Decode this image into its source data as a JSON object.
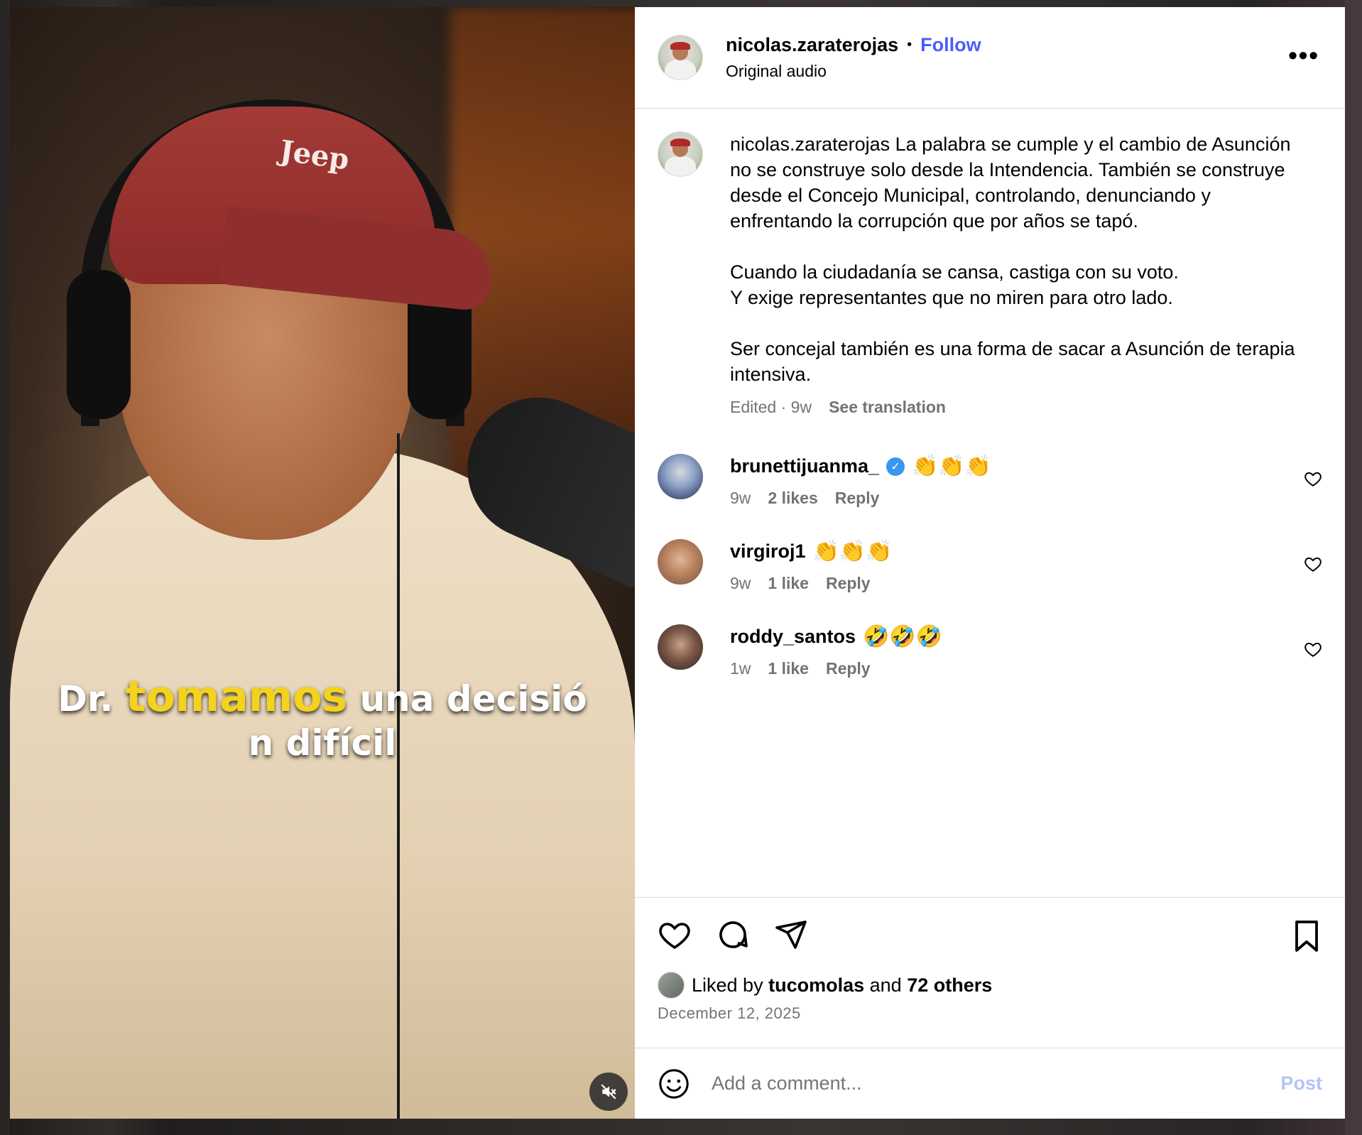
{
  "post": {
    "username": "nicolas.zaraterojas",
    "separator": "•",
    "follow_label": "Follow",
    "audio": "Original audio",
    "more_label": "•••",
    "caption_user": "nicolas.zaraterojas",
    "caption_p1": "La palabra se cumple y el cambio de Asunción no se construye solo desde la Intendencia. También se construye desde el Concejo Municipal, controlando, denunciando y enfrentando la corrupción que por años se tapó.",
    "caption_p2": "Cuando la ciudadanía se cansa, castiga con su voto.\nY exige representantes que no miren para otro lado.",
    "caption_p3": "Ser concejal también es una forma de sacar a Asunción de terapia intensiva.",
    "caption_meta": "Edited · 9w",
    "translation_label": "See translation"
  },
  "video": {
    "caption_line1_a": "Dr.",
    "caption_line1_hl": "tomamos",
    "caption_line1_b": "una decisió",
    "caption_line2": "n difícil",
    "cap_logo": "Jeep"
  },
  "comments": [
    {
      "user": "brunettijuanma_",
      "verified": true,
      "text": "👏👏👏",
      "age": "9w",
      "likes": "2 likes",
      "reply": "Reply"
    },
    {
      "user": "virgiroj1",
      "verified": false,
      "text": "👏👏👏",
      "age": "9w",
      "likes": "1 like",
      "reply": "Reply"
    },
    {
      "user": "roddy_santos",
      "verified": false,
      "text": "🤣🤣🤣",
      "age": "1w",
      "likes": "1 like",
      "reply": "Reply"
    }
  ],
  "footer": {
    "liked_prefix": "Liked by",
    "liked_user": "tucomolas",
    "liked_and": "and",
    "liked_others": "72 others",
    "date": "December 12, 2025",
    "comment_placeholder": "Add a comment...",
    "post_label": "Post"
  },
  "icons": {
    "like": "heart-icon",
    "comment": "comment-icon",
    "share": "send-icon",
    "save": "bookmark-icon",
    "emoji": "emoji-icon",
    "mute": "muted-speaker-icon",
    "verified": "verified-badge-icon"
  },
  "colors": {
    "follow": "#4a5df9",
    "secondary_text": "#737373",
    "verified": "#3897f0",
    "post_disabled": "#b4c3f7",
    "caption_highlight": "#f5d21b"
  }
}
